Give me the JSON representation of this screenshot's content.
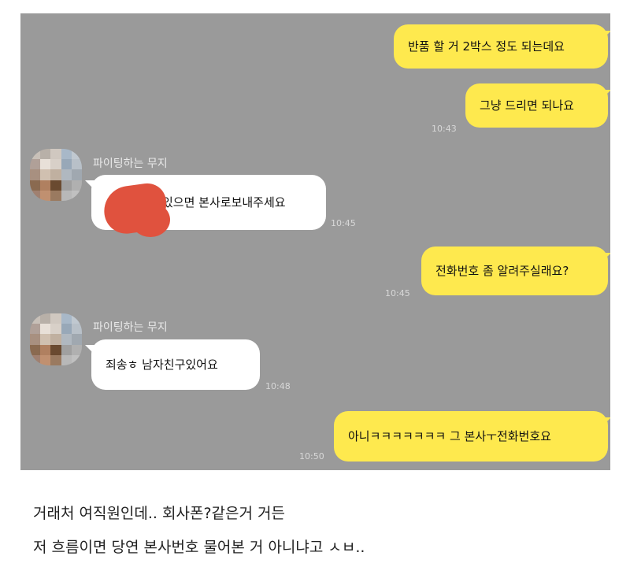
{
  "chat": {
    "messages": [
      {
        "sender": "me",
        "text": "반품 할 거 2박스 정도 되는데요",
        "time": ""
      },
      {
        "sender": "me",
        "text": "그냥 드리면 되나요",
        "time": "10:43"
      },
      {
        "sender": "other",
        "name": "파이팅하는 무지",
        "text": "있으면 본사로보내주세요",
        "time": "10:45"
      },
      {
        "sender": "me",
        "text": "전화번호 좀 알려주실래요?",
        "time": "10:45"
      },
      {
        "sender": "other",
        "name": "파이팅하는 무지",
        "text": "죄송ㅎ 남자친구있어요",
        "time": "10:48"
      },
      {
        "sender": "me",
        "text": "아니ㅋㅋㅋㅋㅋㅋㅋ 그 본사ㅜ전화번호요",
        "time": "10:50"
      }
    ]
  },
  "caption": {
    "line1": "거래처 여직원인데.. 회사폰?같은거 거든",
    "line2": "저 흐름이면 당연 본사번호 물어본 거 아니냐고 ㅅㅂ.."
  },
  "colors": {
    "chat_background": "#9a9a9a",
    "my_bubble": "#fee94e",
    "other_bubble": "#ffffff",
    "redaction": "#e0523e"
  }
}
